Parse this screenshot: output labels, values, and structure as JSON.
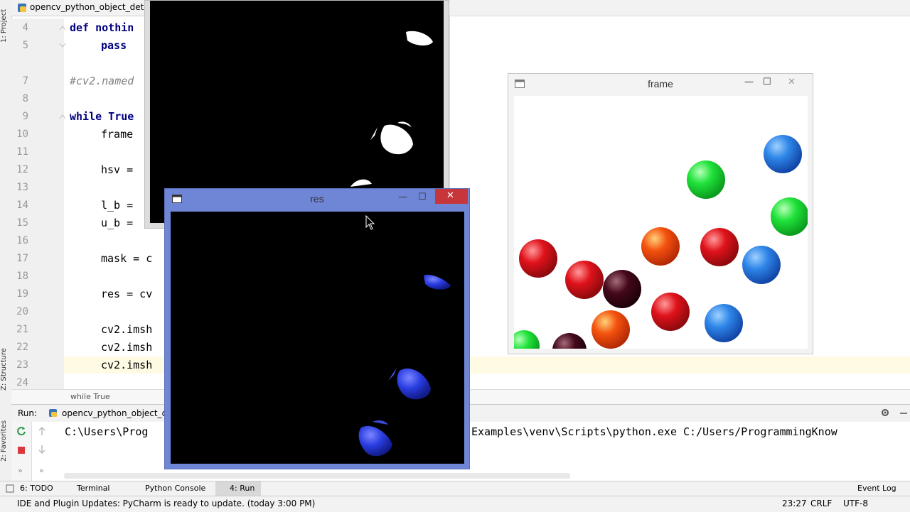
{
  "editor": {
    "tab_title": "opencv_python_object_detect",
    "lines": [
      {
        "num": "4",
        "code": "def nothin"
      },
      {
        "num": "5",
        "code": "pass"
      },
      {
        "num": "7",
        "code": "#cv2.named"
      },
      {
        "num": "8",
        "code": ""
      },
      {
        "num": "9",
        "code": "while True"
      },
      {
        "num": "10",
        "code": "frame"
      },
      {
        "num": "11",
        "code": ""
      },
      {
        "num": "12",
        "code": "hsv ="
      },
      {
        "num": "13",
        "code": ""
      },
      {
        "num": "14",
        "code": "l_b ="
      },
      {
        "num": "15",
        "code": "u_b ="
      },
      {
        "num": "16",
        "code": ""
      },
      {
        "num": "17",
        "code": "mask = c"
      },
      {
        "num": "18",
        "code": ""
      },
      {
        "num": "19",
        "code": "res = cv"
      },
      {
        "num": "20",
        "code": ""
      },
      {
        "num": "21",
        "code": "cv2.imsh"
      },
      {
        "num": "22",
        "code": "cv2.imsh"
      },
      {
        "num": "23",
        "code": "cv2.imsh"
      },
      {
        "num": "24",
        "code": ""
      }
    ],
    "breadcrumb": "while True"
  },
  "left_stripe": {
    "project": "1: Project",
    "structure": "Z: Structure",
    "favorites": "2: Favorites"
  },
  "run_panel": {
    "label": "Run:",
    "tab": "opencv_python_object_detec",
    "console_left": "C:\\Users\\Prog",
    "console_right": "Examples\\venv\\Scripts\\python.exe C:/Users/ProgrammingKnow"
  },
  "bottom_tabs": {
    "todo": "6: TODO",
    "terminal": "Terminal",
    "python_console": "Python Console",
    "run": "4: Run",
    "event_log": "Event Log"
  },
  "status_bar": {
    "message": "IDE and Plugin Updates: PyCharm is ready to update. (today 3:00 PM)",
    "position": "23:27",
    "line_sep": "CRLF",
    "encoding": "UTF-8"
  },
  "windows": {
    "res": {
      "title": "res"
    },
    "frame": {
      "title": "frame"
    }
  },
  "colors": {
    "res_titlebar": "#6f86d6",
    "close_red": "#c7363a",
    "keyword": "#000080"
  }
}
